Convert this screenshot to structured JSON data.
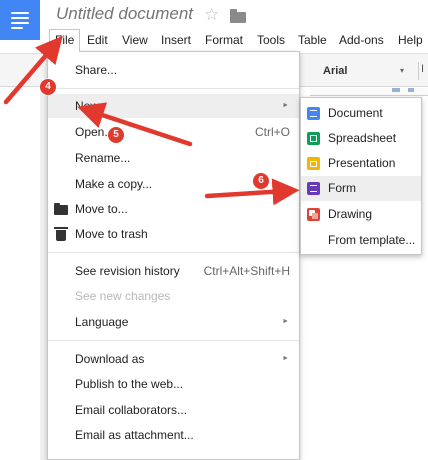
{
  "app": {
    "document_title": "Untitled document"
  },
  "menubar": {
    "items": [
      {
        "label": "File"
      },
      {
        "label": "Edit"
      },
      {
        "label": "View"
      },
      {
        "label": "Insert"
      },
      {
        "label": "Format"
      },
      {
        "label": "Tools"
      },
      {
        "label": "Table"
      },
      {
        "label": "Add-ons"
      },
      {
        "label": "Help"
      }
    ]
  },
  "toolbar": {
    "font_name": "Arial",
    "font_caret": "▾",
    "italic_glyph": "I"
  },
  "file_menu": {
    "items": [
      {
        "label": "Share..."
      },
      {
        "label": "New",
        "submenu_arrow": "►"
      },
      {
        "label": "Open...",
        "shortcut": "Ctrl+O"
      },
      {
        "label": "Rename..."
      },
      {
        "label": "Make a copy..."
      },
      {
        "label": "Move to...",
        "icon": "folder-icon"
      },
      {
        "label": "Move to trash",
        "icon": "trash-icon"
      },
      {
        "label": "See revision history",
        "shortcut": "Ctrl+Alt+Shift+H"
      },
      {
        "label": "See new changes",
        "disabled": true
      },
      {
        "label": "Language",
        "submenu_arrow": "►"
      },
      {
        "label": "Download as",
        "submenu_arrow": "►"
      },
      {
        "label": "Publish to the web..."
      },
      {
        "label": "Email collaborators..."
      },
      {
        "label": "Email as attachment..."
      }
    ]
  },
  "new_submenu": {
    "items": [
      {
        "label": "Document",
        "icon": "document-icon",
        "color": "#4285f4"
      },
      {
        "label": "Spreadsheet",
        "icon": "spreadsheet-icon",
        "color": "#0f9d58"
      },
      {
        "label": "Presentation",
        "icon": "presentation-icon",
        "color": "#f4b400"
      },
      {
        "label": "Form",
        "icon": "form-icon",
        "color": "#673ab7"
      },
      {
        "label": "Drawing",
        "icon": "drawing-icon",
        "color": "#db4437"
      },
      {
        "label": "From template..."
      }
    ]
  },
  "annotations": {
    "steps": [
      "4",
      "5",
      "6"
    ],
    "arrow_color": "#e2392f"
  },
  "colors": {
    "brand_blue": "#4285f4",
    "menu_hover": "#eeeeee",
    "annotation_red": "#e2392f"
  }
}
